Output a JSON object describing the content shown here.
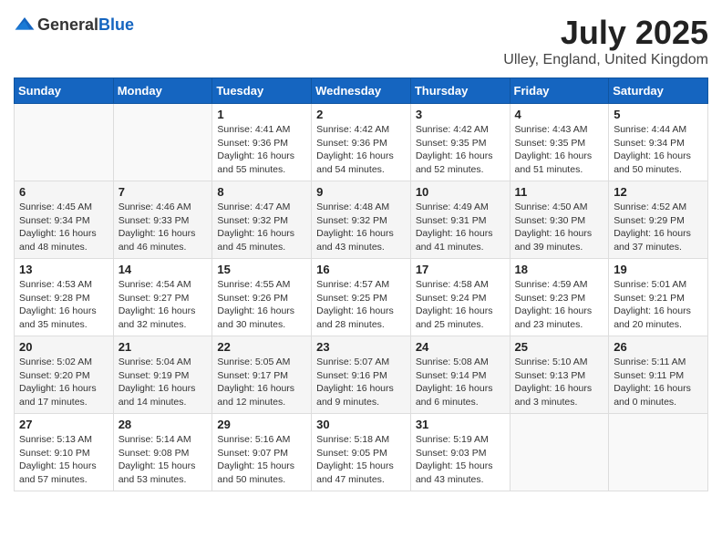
{
  "header": {
    "logo_general": "General",
    "logo_blue": "Blue",
    "month_title": "July 2025",
    "location": "Ulley, England, United Kingdom"
  },
  "days_of_week": [
    "Sunday",
    "Monday",
    "Tuesday",
    "Wednesday",
    "Thursday",
    "Friday",
    "Saturday"
  ],
  "weeks": [
    [
      {
        "day": "",
        "info": ""
      },
      {
        "day": "",
        "info": ""
      },
      {
        "day": "1",
        "info": "Sunrise: 4:41 AM\nSunset: 9:36 PM\nDaylight: 16 hours\nand 55 minutes."
      },
      {
        "day": "2",
        "info": "Sunrise: 4:42 AM\nSunset: 9:36 PM\nDaylight: 16 hours\nand 54 minutes."
      },
      {
        "day": "3",
        "info": "Sunrise: 4:42 AM\nSunset: 9:35 PM\nDaylight: 16 hours\nand 52 minutes."
      },
      {
        "day": "4",
        "info": "Sunrise: 4:43 AM\nSunset: 9:35 PM\nDaylight: 16 hours\nand 51 minutes."
      },
      {
        "day": "5",
        "info": "Sunrise: 4:44 AM\nSunset: 9:34 PM\nDaylight: 16 hours\nand 50 minutes."
      }
    ],
    [
      {
        "day": "6",
        "info": "Sunrise: 4:45 AM\nSunset: 9:34 PM\nDaylight: 16 hours\nand 48 minutes."
      },
      {
        "day": "7",
        "info": "Sunrise: 4:46 AM\nSunset: 9:33 PM\nDaylight: 16 hours\nand 46 minutes."
      },
      {
        "day": "8",
        "info": "Sunrise: 4:47 AM\nSunset: 9:32 PM\nDaylight: 16 hours\nand 45 minutes."
      },
      {
        "day": "9",
        "info": "Sunrise: 4:48 AM\nSunset: 9:32 PM\nDaylight: 16 hours\nand 43 minutes."
      },
      {
        "day": "10",
        "info": "Sunrise: 4:49 AM\nSunset: 9:31 PM\nDaylight: 16 hours\nand 41 minutes."
      },
      {
        "day": "11",
        "info": "Sunrise: 4:50 AM\nSunset: 9:30 PM\nDaylight: 16 hours\nand 39 minutes."
      },
      {
        "day": "12",
        "info": "Sunrise: 4:52 AM\nSunset: 9:29 PM\nDaylight: 16 hours\nand 37 minutes."
      }
    ],
    [
      {
        "day": "13",
        "info": "Sunrise: 4:53 AM\nSunset: 9:28 PM\nDaylight: 16 hours\nand 35 minutes."
      },
      {
        "day": "14",
        "info": "Sunrise: 4:54 AM\nSunset: 9:27 PM\nDaylight: 16 hours\nand 32 minutes."
      },
      {
        "day": "15",
        "info": "Sunrise: 4:55 AM\nSunset: 9:26 PM\nDaylight: 16 hours\nand 30 minutes."
      },
      {
        "day": "16",
        "info": "Sunrise: 4:57 AM\nSunset: 9:25 PM\nDaylight: 16 hours\nand 28 minutes."
      },
      {
        "day": "17",
        "info": "Sunrise: 4:58 AM\nSunset: 9:24 PM\nDaylight: 16 hours\nand 25 minutes."
      },
      {
        "day": "18",
        "info": "Sunrise: 4:59 AM\nSunset: 9:23 PM\nDaylight: 16 hours\nand 23 minutes."
      },
      {
        "day": "19",
        "info": "Sunrise: 5:01 AM\nSunset: 9:21 PM\nDaylight: 16 hours\nand 20 minutes."
      }
    ],
    [
      {
        "day": "20",
        "info": "Sunrise: 5:02 AM\nSunset: 9:20 PM\nDaylight: 16 hours\nand 17 minutes."
      },
      {
        "day": "21",
        "info": "Sunrise: 5:04 AM\nSunset: 9:19 PM\nDaylight: 16 hours\nand 14 minutes."
      },
      {
        "day": "22",
        "info": "Sunrise: 5:05 AM\nSunset: 9:17 PM\nDaylight: 16 hours\nand 12 minutes."
      },
      {
        "day": "23",
        "info": "Sunrise: 5:07 AM\nSunset: 9:16 PM\nDaylight: 16 hours\nand 9 minutes."
      },
      {
        "day": "24",
        "info": "Sunrise: 5:08 AM\nSunset: 9:14 PM\nDaylight: 16 hours\nand 6 minutes."
      },
      {
        "day": "25",
        "info": "Sunrise: 5:10 AM\nSunset: 9:13 PM\nDaylight: 16 hours\nand 3 minutes."
      },
      {
        "day": "26",
        "info": "Sunrise: 5:11 AM\nSunset: 9:11 PM\nDaylight: 16 hours\nand 0 minutes."
      }
    ],
    [
      {
        "day": "27",
        "info": "Sunrise: 5:13 AM\nSunset: 9:10 PM\nDaylight: 15 hours\nand 57 minutes."
      },
      {
        "day": "28",
        "info": "Sunrise: 5:14 AM\nSunset: 9:08 PM\nDaylight: 15 hours\nand 53 minutes."
      },
      {
        "day": "29",
        "info": "Sunrise: 5:16 AM\nSunset: 9:07 PM\nDaylight: 15 hours\nand 50 minutes."
      },
      {
        "day": "30",
        "info": "Sunrise: 5:18 AM\nSunset: 9:05 PM\nDaylight: 15 hours\nand 47 minutes."
      },
      {
        "day": "31",
        "info": "Sunrise: 5:19 AM\nSunset: 9:03 PM\nDaylight: 15 hours\nand 43 minutes."
      },
      {
        "day": "",
        "info": ""
      },
      {
        "day": "",
        "info": ""
      }
    ]
  ]
}
